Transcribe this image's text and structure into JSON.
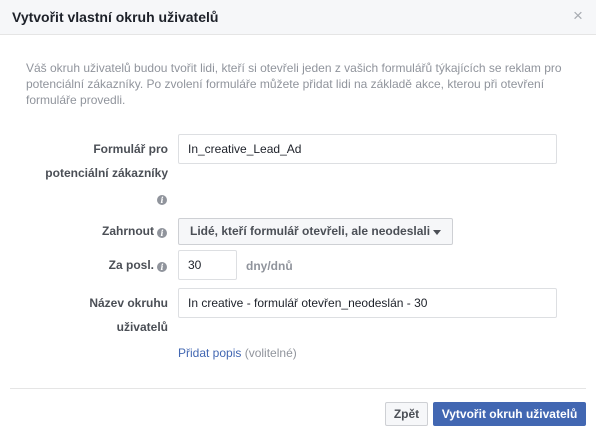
{
  "dialog": {
    "title": "Vytvořit vlastní okruh uživatelů",
    "close_symbol": "×",
    "description": "Váš okruh uživatelů budou tvořit lidi, kteří si otevřeli jeden z vašich formulářů týkajících se reklam pro potenciální zákazníky. Po zvolení formuláře můžete přidat lidi na základě akce, kterou při otevření formuláře provedli."
  },
  "form": {
    "lead_form": {
      "label_line1": "Formulář pro",
      "label_line2": "potenciální zákazníky",
      "value": "In_creative_Lead_Ad"
    },
    "include": {
      "label": "Zahrnout",
      "selected": "Lidé, kteří formulář otevřeli, ale neodeslali"
    },
    "last_days": {
      "label": "Za posl.",
      "value": "30",
      "unit": "dny/dnů"
    },
    "audience_name": {
      "label_line1": "Název okruhu",
      "label_line2": "uživatelů",
      "value": "In creative - formulář otevřen_neodeslán - 30"
    },
    "add_description": {
      "link": "Přidat popis",
      "optional": "(volitelné)"
    }
  },
  "footer": {
    "back_label": "Zpět",
    "create_label": "Vytvořit okruh uživatelů"
  },
  "icons": {
    "info": "i"
  },
  "colors": {
    "primary": "#4267b2",
    "label": "#4b4f56",
    "muted": "#90949c",
    "border": "#dddfe2"
  }
}
